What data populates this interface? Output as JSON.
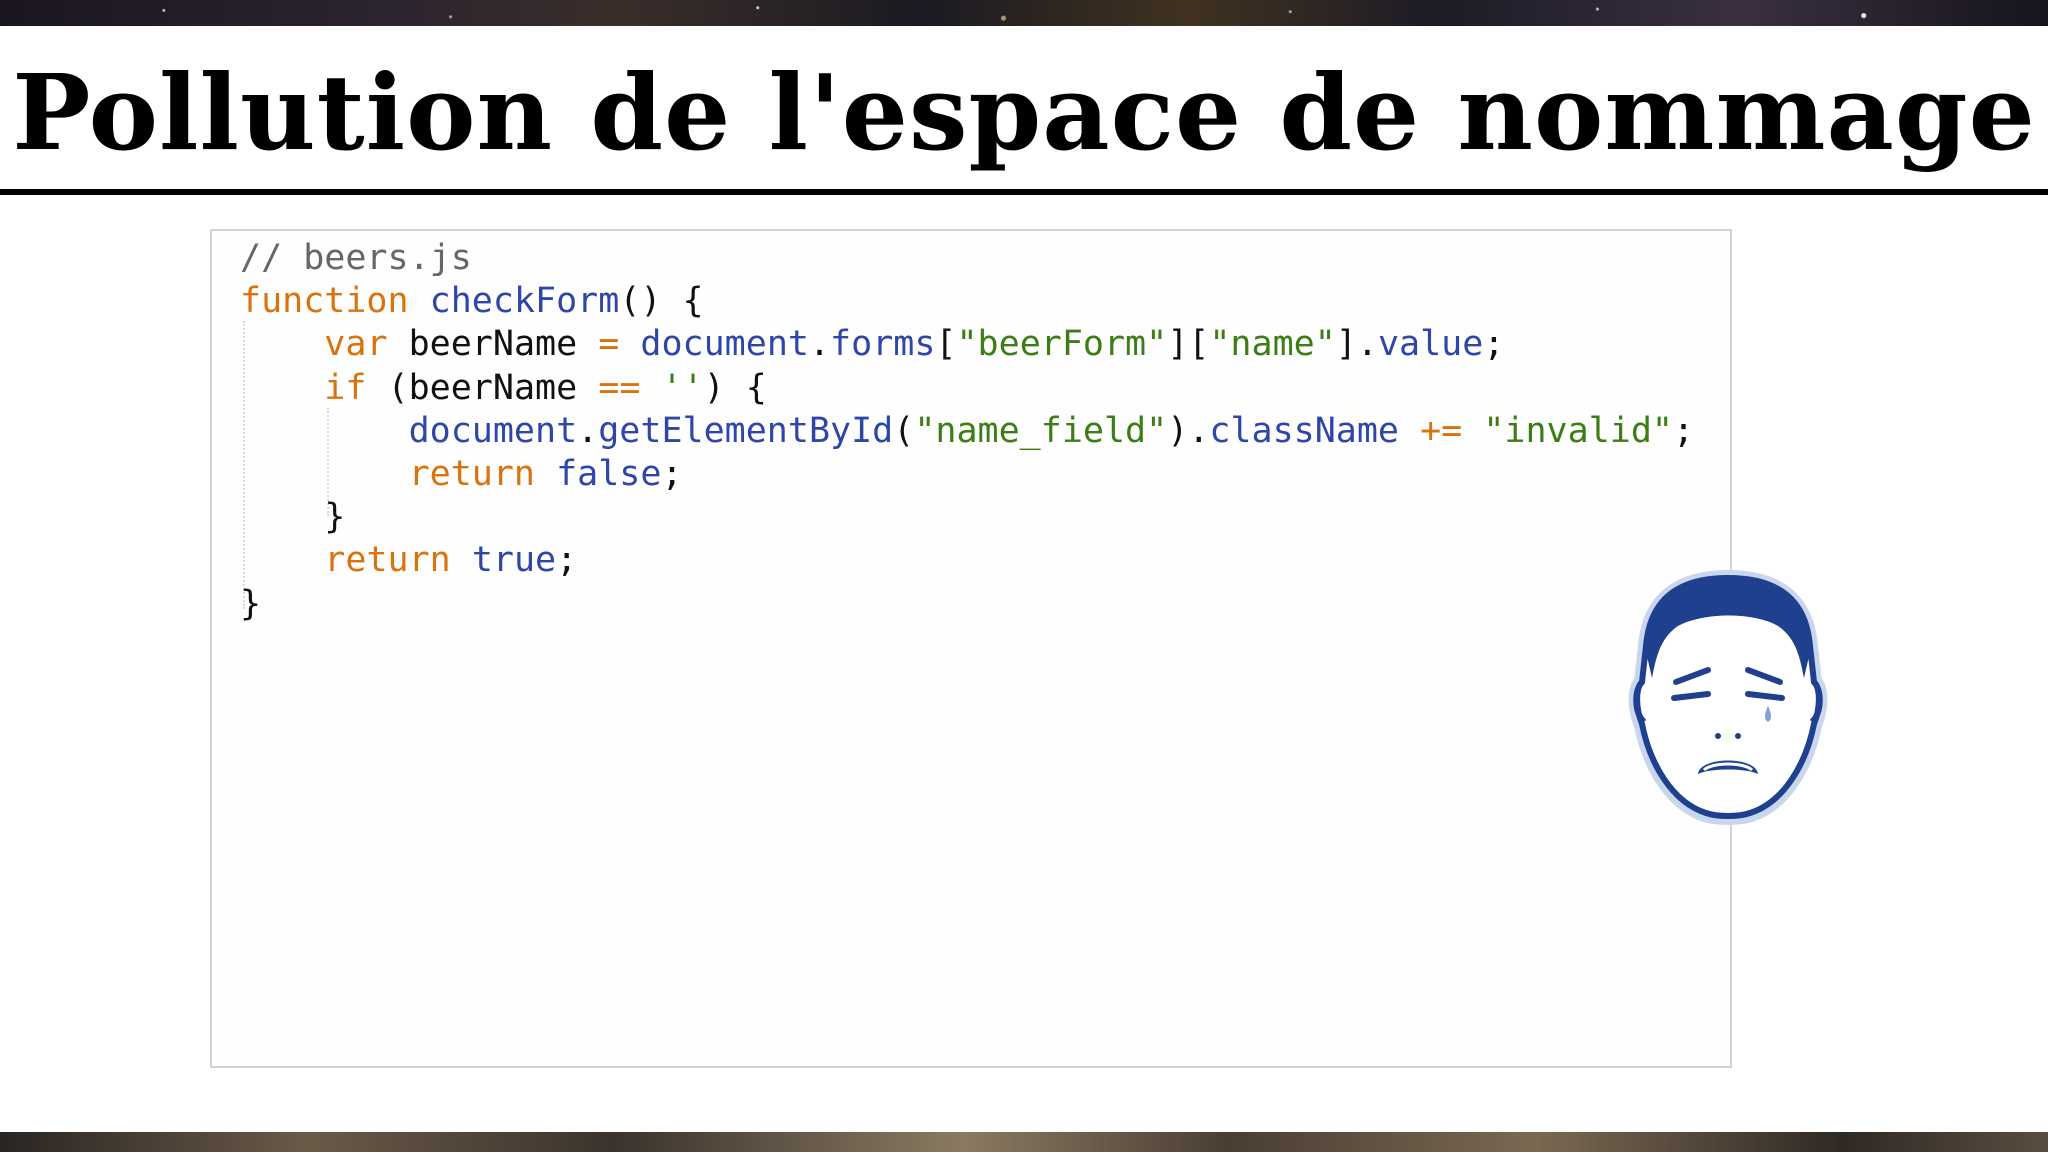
{
  "slide": {
    "title": "Pollution de l'espace de nommage"
  },
  "code": {
    "lines": [
      [
        {
          "t": "// beers.js",
          "c": "comment"
        }
      ],
      [
        {
          "t": "function",
          "c": "kw"
        },
        {
          "t": " ",
          "c": "plain"
        },
        {
          "t": "checkForm",
          "c": "fn"
        },
        {
          "t": "() {",
          "c": "plain"
        }
      ],
      [
        {
          "t": "    ",
          "c": "plain"
        },
        {
          "t": "var",
          "c": "kw"
        },
        {
          "t": " beerName ",
          "c": "plain"
        },
        {
          "t": "=",
          "c": "op"
        },
        {
          "t": " ",
          "c": "plain"
        },
        {
          "t": "document",
          "c": "prop"
        },
        {
          "t": ".",
          "c": "plain"
        },
        {
          "t": "forms",
          "c": "prop"
        },
        {
          "t": "[",
          "c": "plain"
        },
        {
          "t": "\"beerForm\"",
          "c": "str"
        },
        {
          "t": "][",
          "c": "plain"
        },
        {
          "t": "\"name\"",
          "c": "str"
        },
        {
          "t": "].",
          "c": "plain"
        },
        {
          "t": "value",
          "c": "prop"
        },
        {
          "t": ";",
          "c": "plain"
        }
      ],
      [
        {
          "t": "    ",
          "c": "plain"
        },
        {
          "t": "if",
          "c": "kw"
        },
        {
          "t": " (beerName ",
          "c": "plain"
        },
        {
          "t": "==",
          "c": "op"
        },
        {
          "t": " ",
          "c": "plain"
        },
        {
          "t": "''",
          "c": "str"
        },
        {
          "t": ") {",
          "c": "plain"
        }
      ],
      [
        {
          "t": "        ",
          "c": "plain"
        },
        {
          "t": "document",
          "c": "prop"
        },
        {
          "t": ".",
          "c": "plain"
        },
        {
          "t": "getElementById",
          "c": "fn"
        },
        {
          "t": "(",
          "c": "plain"
        },
        {
          "t": "\"name_field\"",
          "c": "str"
        },
        {
          "t": ").",
          "c": "plain"
        },
        {
          "t": "className",
          "c": "prop"
        },
        {
          "t": " ",
          "c": "plain"
        },
        {
          "t": "+=",
          "c": "op"
        },
        {
          "t": " ",
          "c": "plain"
        },
        {
          "t": "\"invalid\"",
          "c": "str"
        },
        {
          "t": ";",
          "c": "plain"
        }
      ],
      [
        {
          "t": "        ",
          "c": "plain"
        },
        {
          "t": "return",
          "c": "kw"
        },
        {
          "t": " ",
          "c": "plain"
        },
        {
          "t": "false",
          "c": "fn"
        },
        {
          "t": ";",
          "c": "plain"
        }
      ],
      [
        {
          "t": "    }",
          "c": "plain"
        }
      ],
      [
        {
          "t": "    ",
          "c": "plain"
        },
        {
          "t": "return",
          "c": "kw"
        },
        {
          "t": " ",
          "c": "plain"
        },
        {
          "t": "true",
          "c": "fn"
        },
        {
          "t": ";",
          "c": "plain"
        }
      ],
      [
        {
          "t": "}",
          "c": "plain"
        }
      ]
    ]
  },
  "colors": {
    "keyword": "#d9730d",
    "function": "#2f46a8",
    "string": "#3c7d14",
    "comment": "#666666",
    "face_outline": "#1f3f8f"
  },
  "icons": {
    "face": "crying-face-icon"
  }
}
